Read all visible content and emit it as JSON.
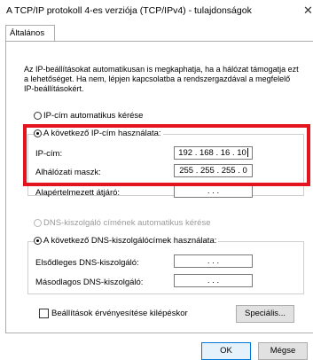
{
  "window": {
    "title": "A TCP/IP protokoll 4-es verziója (TCP/IPv4) - tulajdonságok",
    "close_glyph": "✕"
  },
  "tab": {
    "label": "Általános"
  },
  "intro_text": "Az IP-beállításokat automatikusan is megkaphatja, ha a hálózat támogatja ezt a lehetőséget. Ha nem, lépjen kapcsolatba a rendszergazdával a megfelelő IP-beállításokért.",
  "ip_section": {
    "auto_label": "IP-cím automatikus kérése",
    "manual_label": "A következő IP-cím használata:",
    "ip_label": "IP-cím:",
    "ip_value": "192 . 168 . 16 . 10",
    "mask_label": "Alhálózati maszk:",
    "mask_value": "255 . 255 . 255 . 0",
    "gateway_label": "Alapértelmezett átjáró:",
    "gateway_value": ". . ."
  },
  "dns_section": {
    "auto_label": "DNS-kiszolgáló címének automatikus kérése",
    "manual_label": "A következő DNS-kiszolgálócímek használata:",
    "primary_label": "Elsődleges DNS-kiszolgáló:",
    "primary_value": ". . .",
    "secondary_label": "Másodlagos DNS-kiszolgáló:",
    "secondary_value": ". . ."
  },
  "validate_label": "Beállítások érvényesítése kilépéskor",
  "buttons": {
    "advanced": "Speciális...",
    "ok": "OK",
    "cancel": "Mégse"
  },
  "colors": {
    "highlight": "#e3141d",
    "default_button_border": "#0078d7"
  }
}
